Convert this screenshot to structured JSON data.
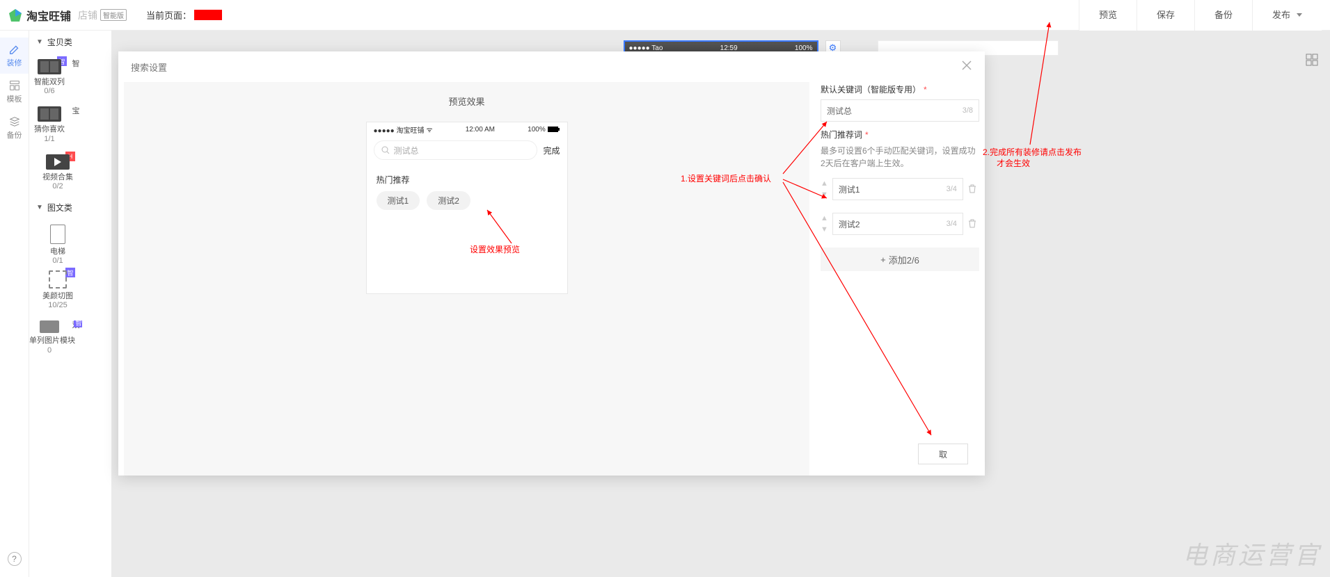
{
  "header": {
    "app_name": "淘宝旺铺",
    "shop_label": "店铺",
    "smart_badge": "智能版",
    "current_page_label": "当前页面：",
    "actions": {
      "preview": "预览",
      "save": "保存",
      "backup": "备份",
      "publish": "发布"
    }
  },
  "rail": {
    "decorate": "装修",
    "template": "模板",
    "backup": "备份"
  },
  "sidebar": {
    "section_goods": "宝贝类",
    "section_image": "图文类",
    "tiles": {
      "smart_dual": {
        "label": "智能双列",
        "count": "0/6",
        "badge": "智"
      },
      "smart_cut": {
        "label": "智",
        "count": ""
      },
      "guess_like": {
        "label": "猜你喜欢",
        "count": "1/1"
      },
      "baobei": {
        "label": "宝"
      },
      "video_set": {
        "label": "视频合集",
        "count": "0/2",
        "badge": "H"
      },
      "elevator": {
        "label": "电梯",
        "count": "0/1"
      },
      "beauty_crop": {
        "label": "美颜切图",
        "count": "10/25",
        "badge": "智"
      },
      "single_img": {
        "label": "单列图片模块",
        "count": "0"
      },
      "double_cut": {
        "label": "双",
        "badge": "智"
      }
    }
  },
  "canvas": {
    "phone_top_left": "●●●●● Tao",
    "phone_top_time": "12:59",
    "phone_top_right": "100%",
    "gear": "⚙"
  },
  "modal": {
    "title": "搜索设置",
    "preview_title": "预览效果",
    "phone": {
      "carrier": "●●●●● 淘宝旺铺",
      "wifi": "ᯤ",
      "time": "12:00 AM",
      "battery": "100%",
      "search_text": "测试总",
      "done": "完成",
      "hot_title": "热门推荐",
      "chips": [
        "测试1",
        "测试2"
      ]
    },
    "form": {
      "default_kw_label": "默认关键词（智能版专用）",
      "default_kw_value": "测试总",
      "default_kw_count": "3/8",
      "hot_kw_label": "热门推荐词",
      "hint": "最多可设置6个手动匹配关键词，设置成功2天后在客户端上生效。",
      "kw1": {
        "value": "测试1",
        "count": "3/4"
      },
      "kw2": {
        "value": "测试2",
        "count": "3/4"
      },
      "add_label": "添加2/6",
      "cancel": "取"
    }
  },
  "annotations": {
    "a1": "1.设置关键词后点击确认",
    "a2_line1": "2.完成所有装修请点击发布",
    "a2_line2": "才会生效",
    "preview_note": "设置效果预览"
  },
  "watermark": "电商运营官"
}
